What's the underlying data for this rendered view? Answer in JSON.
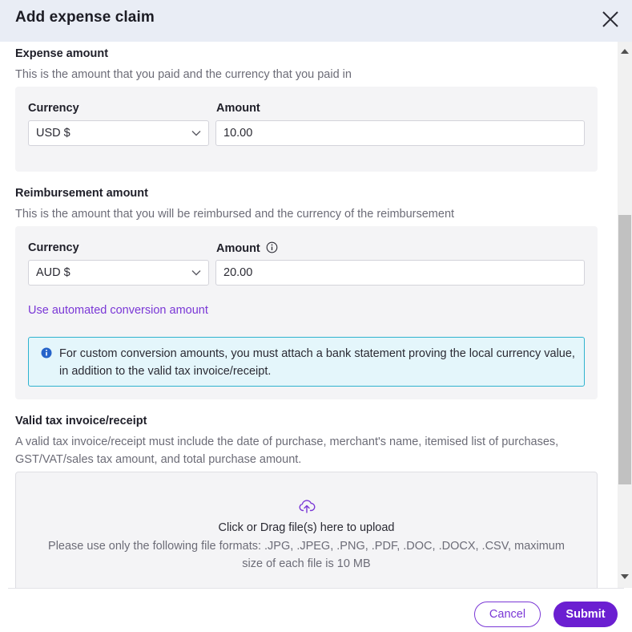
{
  "dialog": {
    "title": "Add expense claim",
    "close_icon": "close-icon"
  },
  "expense_amount": {
    "title": "Expense amount",
    "description": "This is the amount that you paid and the currency that you paid in",
    "currency_label": "Currency",
    "currency_value": "USD $",
    "amount_label": "Amount",
    "amount_value": "10.00"
  },
  "reimbursement_amount": {
    "title": "Reimbursement amount",
    "description": "This is the amount that you will be reimbursed and the currency of the reimbursement",
    "currency_label": "Currency",
    "currency_value": "AUD $",
    "amount_label": "Amount",
    "amount_info_icon": "info-circle-icon",
    "amount_value": "20.00",
    "conversion_link": "Use automated conversion amount",
    "info_message": "For custom conversion amounts, you must attach a bank statement proving the local currency value, in addition to the valid tax invoice/receipt."
  },
  "tax_invoice": {
    "title": "Valid tax invoice/receipt",
    "description": "A valid tax invoice/receipt must include the date of purchase, merchant's name, itemised list of purchases, GST/VAT/sales tax amount, and total purchase amount.",
    "upload_icon": "cloud-upload-icon",
    "upload_title": "Click or Drag file(s) here to upload",
    "upload_hint": "Please use only the following file formats: .JPG, .JPEG, .PNG, .PDF, .DOC, .DOCX, .CSV, maximum size of each file is 10 MB"
  },
  "footer": {
    "cancel_label": "Cancel",
    "submit_label": "Submit"
  },
  "colors": {
    "accent": "#6b1fd1",
    "link": "#7a37d6",
    "header_bg": "#e9edf5",
    "info_bg": "#e4f6fb",
    "info_border": "#2fb3cf"
  }
}
